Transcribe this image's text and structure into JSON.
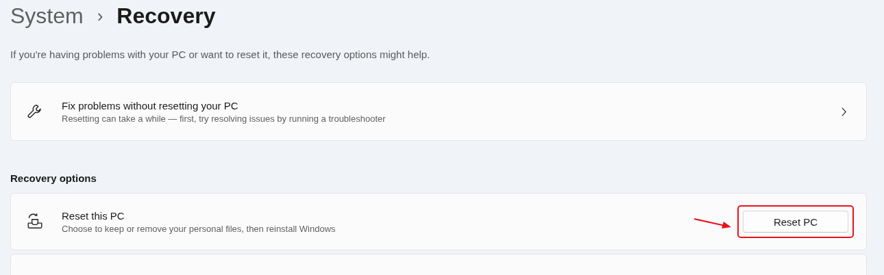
{
  "breadcrumb": {
    "parent": "System",
    "separator": "›",
    "current": "Recovery"
  },
  "description": "If you're having problems with your PC or want to reset it, these recovery options might help.",
  "fix_card": {
    "title": "Fix problems without resetting your PC",
    "subtitle": "Resetting can take a while — first, try resolving issues by running a troubleshooter"
  },
  "section_title": "Recovery options",
  "options": [
    {
      "kind": "button",
      "title": "Reset this PC",
      "subtitle": "Choose to keep or remove your personal files, then reinstall Windows",
      "button": "Reset PC",
      "highlighted": true
    },
    {
      "kind": "empty"
    }
  ]
}
